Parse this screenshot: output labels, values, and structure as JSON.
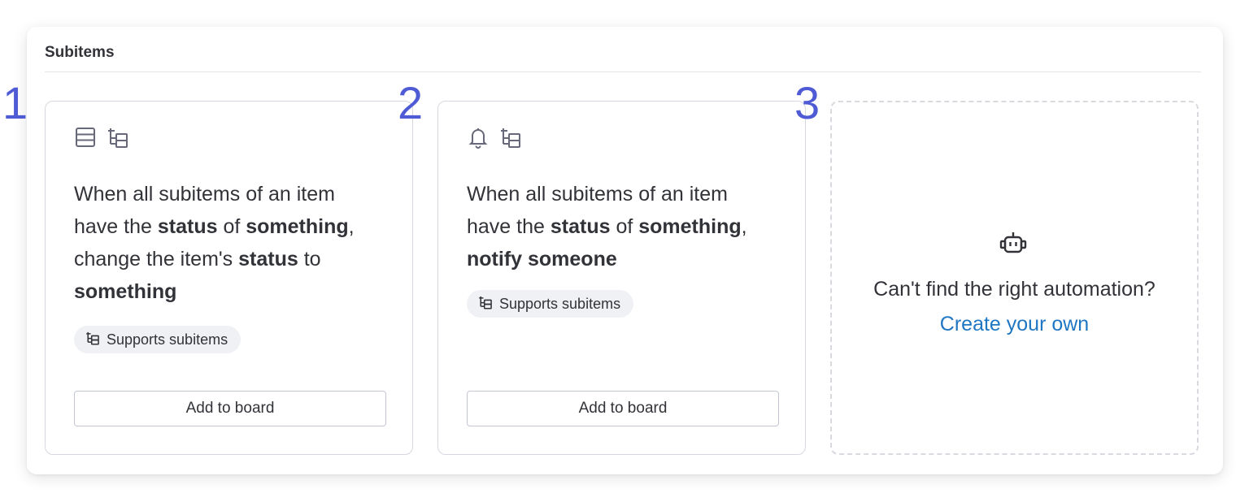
{
  "section": {
    "title": "Subitems"
  },
  "markers": [
    "1",
    "2",
    "3"
  ],
  "cards": [
    {
      "icons": [
        "table-icon",
        "subitems-icon"
      ],
      "text": {
        "l1": "When all subitems of an item",
        "l2_a": "have the ",
        "l2_b": "status",
        "l2_c": " of ",
        "l2_d": "something",
        "l2_e": ",",
        "l3_a": "change the item's ",
        "l3_b": "status",
        "l3_c": " to",
        "l4": "something"
      },
      "tag": "Supports subitems",
      "button": "Add to board"
    },
    {
      "icons": [
        "bell-icon",
        "subitems-icon"
      ],
      "text": {
        "l1": "When all subitems of an item",
        "l2_a": "have the ",
        "l2_b": "status",
        "l2_c": " of ",
        "l2_d": "something",
        "l2_e": ",",
        "l3": "notify someone"
      },
      "tag": "Supports subitems",
      "button": "Add to board"
    }
  ],
  "custom_card": {
    "icon": "robot-icon",
    "prompt": "Can't find the right automation?",
    "link": "Create your own"
  },
  "colors": {
    "marker": "#4f5bd5",
    "link": "#1f76c2",
    "tag_bg": "#f0f1f4"
  }
}
